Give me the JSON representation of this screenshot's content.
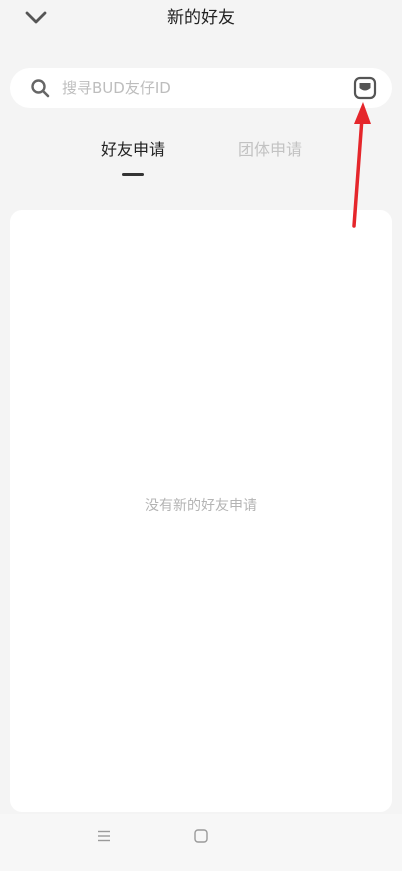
{
  "header": {
    "title": "新的好友",
    "back_icon": "chevron-down-icon"
  },
  "search": {
    "placeholder": "搜寻BUD友仔ID",
    "value": "",
    "search_icon": "search-icon",
    "scan_icon": "scan-icon"
  },
  "tabs": [
    {
      "label": "好友申请",
      "active": true
    },
    {
      "label": "团体申请",
      "active": false
    }
  ],
  "main": {
    "empty_text": "没有新的好友申请"
  },
  "nav": {
    "menu_icon": "menu-icon",
    "home_icon": "home-icon"
  },
  "colors": {
    "background": "#f4f4f4",
    "card": "#ffffff",
    "annotation_arrow": "#e5262b",
    "inactive_tab": "#c2c2c2"
  }
}
